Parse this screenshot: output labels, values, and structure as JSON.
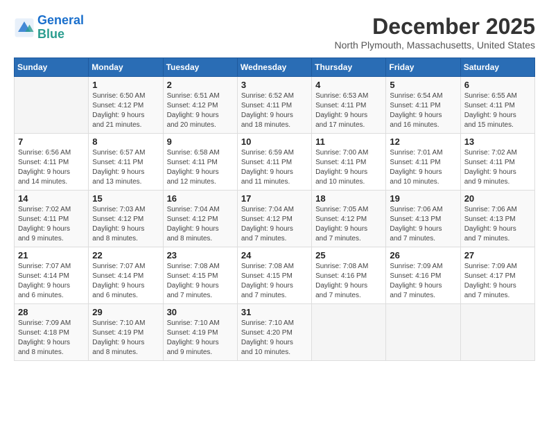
{
  "header": {
    "logo_line1": "General",
    "logo_line2": "Blue",
    "month": "December 2025",
    "location": "North Plymouth, Massachusetts, United States"
  },
  "days_of_week": [
    "Sunday",
    "Monday",
    "Tuesday",
    "Wednesday",
    "Thursday",
    "Friday",
    "Saturday"
  ],
  "weeks": [
    [
      {
        "day": "",
        "info": ""
      },
      {
        "day": "1",
        "info": "Sunrise: 6:50 AM\nSunset: 4:12 PM\nDaylight: 9 hours\nand 21 minutes."
      },
      {
        "day": "2",
        "info": "Sunrise: 6:51 AM\nSunset: 4:12 PM\nDaylight: 9 hours\nand 20 minutes."
      },
      {
        "day": "3",
        "info": "Sunrise: 6:52 AM\nSunset: 4:11 PM\nDaylight: 9 hours\nand 18 minutes."
      },
      {
        "day": "4",
        "info": "Sunrise: 6:53 AM\nSunset: 4:11 PM\nDaylight: 9 hours\nand 17 minutes."
      },
      {
        "day": "5",
        "info": "Sunrise: 6:54 AM\nSunset: 4:11 PM\nDaylight: 9 hours\nand 16 minutes."
      },
      {
        "day": "6",
        "info": "Sunrise: 6:55 AM\nSunset: 4:11 PM\nDaylight: 9 hours\nand 15 minutes."
      }
    ],
    [
      {
        "day": "7",
        "info": "Sunrise: 6:56 AM\nSunset: 4:11 PM\nDaylight: 9 hours\nand 14 minutes."
      },
      {
        "day": "8",
        "info": "Sunrise: 6:57 AM\nSunset: 4:11 PM\nDaylight: 9 hours\nand 13 minutes."
      },
      {
        "day": "9",
        "info": "Sunrise: 6:58 AM\nSunset: 4:11 PM\nDaylight: 9 hours\nand 12 minutes."
      },
      {
        "day": "10",
        "info": "Sunrise: 6:59 AM\nSunset: 4:11 PM\nDaylight: 9 hours\nand 11 minutes."
      },
      {
        "day": "11",
        "info": "Sunrise: 7:00 AM\nSunset: 4:11 PM\nDaylight: 9 hours\nand 10 minutes."
      },
      {
        "day": "12",
        "info": "Sunrise: 7:01 AM\nSunset: 4:11 PM\nDaylight: 9 hours\nand 10 minutes."
      },
      {
        "day": "13",
        "info": "Sunrise: 7:02 AM\nSunset: 4:11 PM\nDaylight: 9 hours\nand 9 minutes."
      }
    ],
    [
      {
        "day": "14",
        "info": "Sunrise: 7:02 AM\nSunset: 4:11 PM\nDaylight: 9 hours\nand 9 minutes."
      },
      {
        "day": "15",
        "info": "Sunrise: 7:03 AM\nSunset: 4:12 PM\nDaylight: 9 hours\nand 8 minutes."
      },
      {
        "day": "16",
        "info": "Sunrise: 7:04 AM\nSunset: 4:12 PM\nDaylight: 9 hours\nand 8 minutes."
      },
      {
        "day": "17",
        "info": "Sunrise: 7:04 AM\nSunset: 4:12 PM\nDaylight: 9 hours\nand 7 minutes."
      },
      {
        "day": "18",
        "info": "Sunrise: 7:05 AM\nSunset: 4:12 PM\nDaylight: 9 hours\nand 7 minutes."
      },
      {
        "day": "19",
        "info": "Sunrise: 7:06 AM\nSunset: 4:13 PM\nDaylight: 9 hours\nand 7 minutes."
      },
      {
        "day": "20",
        "info": "Sunrise: 7:06 AM\nSunset: 4:13 PM\nDaylight: 9 hours\nand 7 minutes."
      }
    ],
    [
      {
        "day": "21",
        "info": "Sunrise: 7:07 AM\nSunset: 4:14 PM\nDaylight: 9 hours\nand 6 minutes."
      },
      {
        "day": "22",
        "info": "Sunrise: 7:07 AM\nSunset: 4:14 PM\nDaylight: 9 hours\nand 6 minutes."
      },
      {
        "day": "23",
        "info": "Sunrise: 7:08 AM\nSunset: 4:15 PM\nDaylight: 9 hours\nand 7 minutes."
      },
      {
        "day": "24",
        "info": "Sunrise: 7:08 AM\nSunset: 4:15 PM\nDaylight: 9 hours\nand 7 minutes."
      },
      {
        "day": "25",
        "info": "Sunrise: 7:08 AM\nSunset: 4:16 PM\nDaylight: 9 hours\nand 7 minutes."
      },
      {
        "day": "26",
        "info": "Sunrise: 7:09 AM\nSunset: 4:16 PM\nDaylight: 9 hours\nand 7 minutes."
      },
      {
        "day": "27",
        "info": "Sunrise: 7:09 AM\nSunset: 4:17 PM\nDaylight: 9 hours\nand 7 minutes."
      }
    ],
    [
      {
        "day": "28",
        "info": "Sunrise: 7:09 AM\nSunset: 4:18 PM\nDaylight: 9 hours\nand 8 minutes."
      },
      {
        "day": "29",
        "info": "Sunrise: 7:10 AM\nSunset: 4:19 PM\nDaylight: 9 hours\nand 8 minutes."
      },
      {
        "day": "30",
        "info": "Sunrise: 7:10 AM\nSunset: 4:19 PM\nDaylight: 9 hours\nand 9 minutes."
      },
      {
        "day": "31",
        "info": "Sunrise: 7:10 AM\nSunset: 4:20 PM\nDaylight: 9 hours\nand 10 minutes."
      },
      {
        "day": "",
        "info": ""
      },
      {
        "day": "",
        "info": ""
      },
      {
        "day": "",
        "info": ""
      }
    ]
  ]
}
